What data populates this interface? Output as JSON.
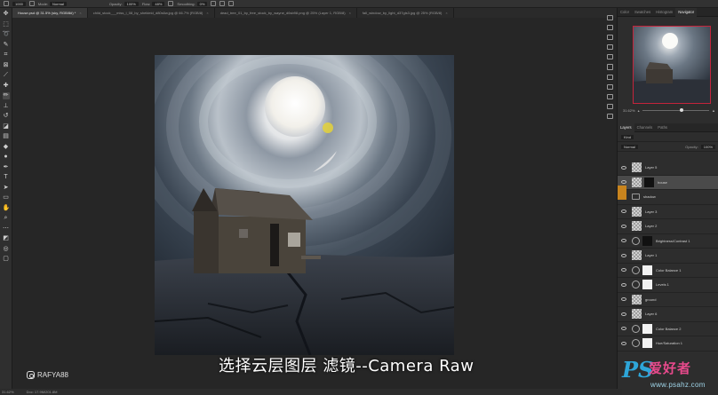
{
  "options_bar": {
    "mode_label": "Mode:",
    "mode_value": "Normal",
    "opacity_label": "Opacity:",
    "opacity_value": "100%",
    "flow_label": "Flow:",
    "flow_value": "48%",
    "smoothing_label": "Smoothing:",
    "smoothing_value": "0%",
    "brush_size": "1000"
  },
  "document_tabs": [
    {
      "label": "House.psd @ 31.5% (sky, RGB/8#) *",
      "active": true
    },
    {
      "label": "child_stock___miss_i_08_by_sheldeid_d80s6w.jpg @ 66.7% (RGB/8)",
      "active": false
    },
    {
      "label": "dead_tree_01_by_free_stock_by_wayne_d6sb98.png @ 25% (Layer 1, RGB/8)",
      "active": false
    },
    {
      "label": "fall_window_by_light_d37gls3.jpg @ 25% (RGB/8)",
      "active": false
    }
  ],
  "right_panel": {
    "top_tabs": [
      "Color",
      "Swatches",
      "Histogram",
      "Navigator"
    ],
    "active_top_tab": "Navigator",
    "zoom": "31.62%",
    "layer_tabs": [
      "Layers",
      "Channels",
      "Paths"
    ],
    "active_layer_tab": "Layers",
    "kind_label": "Kind",
    "blend_mode": "Normal",
    "opacity_label": "Opacity:",
    "opacity_value": "100%",
    "lock_label": "Lock:",
    "fill_label": "Fill:",
    "fill_value": "100%",
    "layers": [
      {
        "name": "Layer 5",
        "kind": "pixel",
        "selected": false,
        "mask": false
      },
      {
        "name": "house",
        "kind": "pixel",
        "selected": true,
        "mask": "dark"
      },
      {
        "name": "shadow",
        "kind": "folder",
        "selected": false,
        "mask": false
      },
      {
        "name": "Layer 3",
        "kind": "pixel",
        "selected": false,
        "mask": false
      },
      {
        "name": "Layer 2",
        "kind": "pixel",
        "selected": false,
        "mask": false
      },
      {
        "name": "Brightness/Contrast 1",
        "kind": "adjustment",
        "selected": false,
        "mask": "dark"
      },
      {
        "name": "Layer 1",
        "kind": "pixel",
        "selected": false,
        "mask": false
      },
      {
        "name": "Color Balance 1",
        "kind": "adjustment",
        "selected": false,
        "mask": "light"
      },
      {
        "name": "Levels 1",
        "kind": "adjustment",
        "selected": false,
        "mask": "light"
      },
      {
        "name": "ground",
        "kind": "pixel",
        "selected": false,
        "mask": false
      },
      {
        "name": "Layer 6",
        "kind": "pixel",
        "selected": false,
        "mask": false
      },
      {
        "name": "Color Balance 2",
        "kind": "adjustment",
        "selected": false,
        "mask": "light"
      },
      {
        "name": "Hue/Saturation 1",
        "kind": "adjustment",
        "selected": false,
        "mask": "light"
      }
    ]
  },
  "status_bar": {
    "zoom": "31.62%",
    "doc_info": "Doc: 17.9M/201.8M"
  },
  "subtitle": "选择云层图层 滤镜--Camera Raw",
  "watermark": {
    "handle": "RAFYA88",
    "logo_ps": "PS",
    "logo_cn": "爱好者",
    "logo_url": "www.psahz.com"
  },
  "colors": {
    "app_bg": "#282828",
    "panel_bg": "#2d2d2d",
    "selected_layer": "#4a4a4a",
    "navigator_frame": "#c4243b",
    "logo_blue": "#2ea6d9",
    "logo_pink": "#e84a8c"
  }
}
